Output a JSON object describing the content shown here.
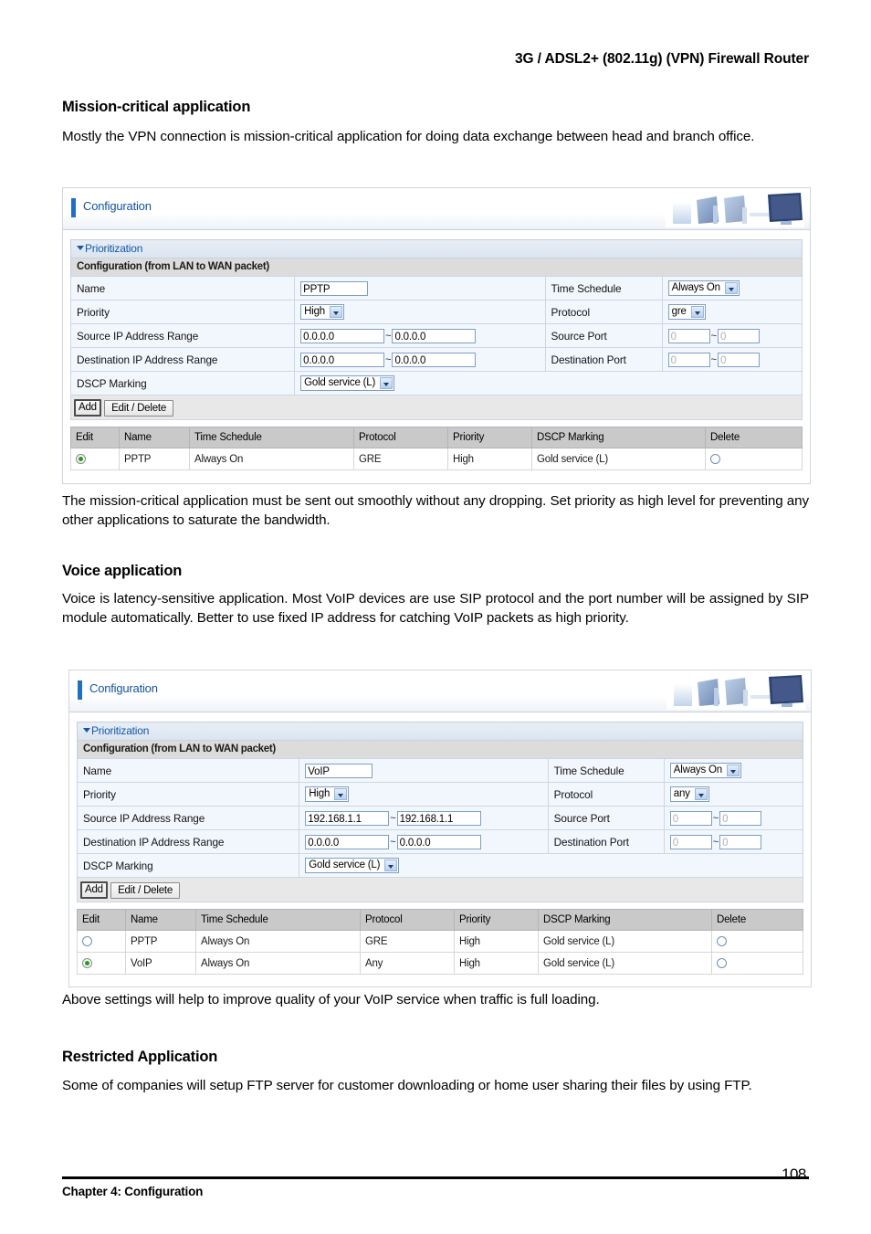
{
  "running_head": "3G / ADSL2+ (802.11g) (VPN) Firewall Router",
  "sections": [
    {
      "heading": "Mission-critical application",
      "intro": "Mostly the VPN connection is mission-critical application for doing data exchange between head and branch office.",
      "outro": "The mission-critical application must be sent out smoothly without any dropping. Set priority as high level for preventing any other applications to saturate the bandwidth."
    },
    {
      "heading": "Voice application",
      "intro": "Voice is latency-sensitive application. Most VoIP devices are use SIP protocol and the port number will be assigned by SIP module automatically. Better to use fixed IP address for catching VoIP packets as high priority.",
      "outro": "Above settings will help to improve quality of your VoIP service when traffic is full loading."
    },
    {
      "heading": "Restricted Application",
      "intro": "Some of companies will setup FTP server for customer downloading or home user sharing their files by using FTP.",
      "outro": ""
    }
  ],
  "panel1": {
    "banner_title": "Configuration",
    "section_title": "Prioritization",
    "subsection_title": "Configuration (from LAN to WAN packet)",
    "labels": {
      "name": "Name",
      "priority": "Priority",
      "source_ip": "Source IP Address Range",
      "dest_ip": "Destination IP Address Range",
      "dscp": "DSCP Marking",
      "time_schedule": "Time Schedule",
      "protocol": "Protocol",
      "source_port": "Source Port",
      "dest_port": "Destination Port"
    },
    "values": {
      "name": "PPTP",
      "priority": "High",
      "source_ip_from": "0.0.0.0",
      "source_ip_to": "0.0.0.0",
      "dest_ip_from": "0.0.0.0",
      "dest_ip_to": "0.0.0.0",
      "dscp": "Gold service (L)",
      "time_schedule": "Always On",
      "protocol": "gre",
      "source_port_from": "0",
      "source_port_to": "0",
      "dest_port_from": "0",
      "dest_port_to": "0"
    },
    "buttons": {
      "add": "Add",
      "edit_delete": "Edit / Delete"
    },
    "table": {
      "headers": [
        "Edit",
        "Name",
        "Time Schedule",
        "Protocol",
        "Priority",
        "DSCP Marking",
        "Delete"
      ],
      "rows": [
        {
          "edit_selected": true,
          "name": "PPTP",
          "time_schedule": "Always On",
          "protocol": "GRE",
          "priority": "High",
          "dscp": "Gold service (L)",
          "delete_selected": false
        }
      ]
    },
    "separator": "~"
  },
  "panel2": {
    "banner_title": "Configuration",
    "section_title": "Prioritization",
    "subsection_title": "Configuration (from LAN to WAN packet)",
    "labels": {
      "name": "Name",
      "priority": "Priority",
      "source_ip": "Source IP Address Range",
      "dest_ip": "Destination IP Address Range",
      "dscp": "DSCP Marking",
      "time_schedule": "Time Schedule",
      "protocol": "Protocol",
      "source_port": "Source Port",
      "dest_port": "Destination Port"
    },
    "values": {
      "name": "VoIP",
      "priority": "High",
      "source_ip_from": "192.168.1.1",
      "source_ip_to": "192.168.1.1",
      "dest_ip_from": "0.0.0.0",
      "dest_ip_to": "0.0.0.0",
      "dscp": "Gold service (L)",
      "time_schedule": "Always On",
      "protocol": "any",
      "source_port_from": "0",
      "source_port_to": "0",
      "dest_port_from": "0",
      "dest_port_to": "0"
    },
    "buttons": {
      "add": "Add",
      "edit_delete": "Edit / Delete"
    },
    "table": {
      "headers": [
        "Edit",
        "Name",
        "Time Schedule",
        "Protocol",
        "Priority",
        "DSCP Marking",
        "Delete"
      ],
      "rows": [
        {
          "edit_selected": false,
          "name": "PPTP",
          "time_schedule": "Always On",
          "protocol": "GRE",
          "priority": "High",
          "dscp": "Gold service (L)",
          "delete_selected": false
        },
        {
          "edit_selected": true,
          "name": "VoIP",
          "time_schedule": "Always On",
          "protocol": "Any",
          "priority": "High",
          "dscp": "Gold service (L)",
          "delete_selected": false
        }
      ]
    },
    "separator": "~"
  },
  "footer": {
    "chapter": "Chapter 4: Configuration",
    "page_number": "108"
  },
  "colors": {
    "accent_blue": "#14529e",
    "label_gray": "#e3e3e3",
    "value_blue": "#f2f7fd",
    "radio_green": "#1aa01a"
  }
}
